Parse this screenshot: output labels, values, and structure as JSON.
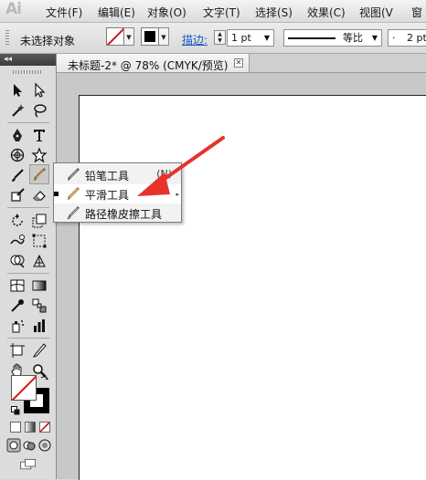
{
  "app": {
    "logo": "Ai",
    "menu": [
      "文件(F)",
      "编辑(E)",
      "对象(O)",
      "文字(T)",
      "选择(S)",
      "效果(C)",
      "视图(V",
      "窗"
    ]
  },
  "controlbar": {
    "selection_label": "未选择对象",
    "stroke_label": "描边:",
    "stroke_weight": "1 pt",
    "profile_label": "等比",
    "brush_size": "2 pt",
    "brush_dot": "·"
  },
  "tools_panel": {
    "collapse_label": "◂◂",
    "icons": [
      "selection-tool-icon",
      "direct-selection-tool-icon",
      "magic-wand-tool-icon",
      "lasso-tool-icon",
      "pen-tool-icon",
      "type-tool-icon",
      "grid-tool-icon",
      "star-tool-icon",
      "paintbrush-tool-icon",
      "pencil-tool-icon",
      "blob-brush-tool-icon",
      "eraser-tool-icon",
      "rotate-tool-icon",
      "scale-tool-icon",
      "warp-tool-icon",
      "free-transform-tool-icon",
      "shape-builder-tool-icon",
      "perspective-tool-icon",
      "mesh-tool-icon",
      "gradient-tool-icon",
      "eyedropper-tool-icon",
      "blend-tool-icon",
      "symbol-sprayer-tool-icon",
      "column-graph-tool-icon",
      "artboard-tool-icon",
      "slice-tool-icon",
      "hand-tool-icon",
      "zoom-tool-icon"
    ]
  },
  "document": {
    "tab_label": "未标题-2* @ 78% (CMYK/预览)",
    "close_glyph": "✕"
  },
  "flyout": {
    "items": [
      {
        "label": "铅笔工具",
        "shortcut": "(N)",
        "current": false
      },
      {
        "label": "平滑工具",
        "shortcut": "",
        "current": true
      },
      {
        "label": "路径橡皮擦工具",
        "shortcut": "",
        "current": false
      }
    ]
  },
  "colors": {
    "accent_link": "#1a55c8",
    "arrow_red": "#e8322c",
    "none_red": "#d21515"
  }
}
